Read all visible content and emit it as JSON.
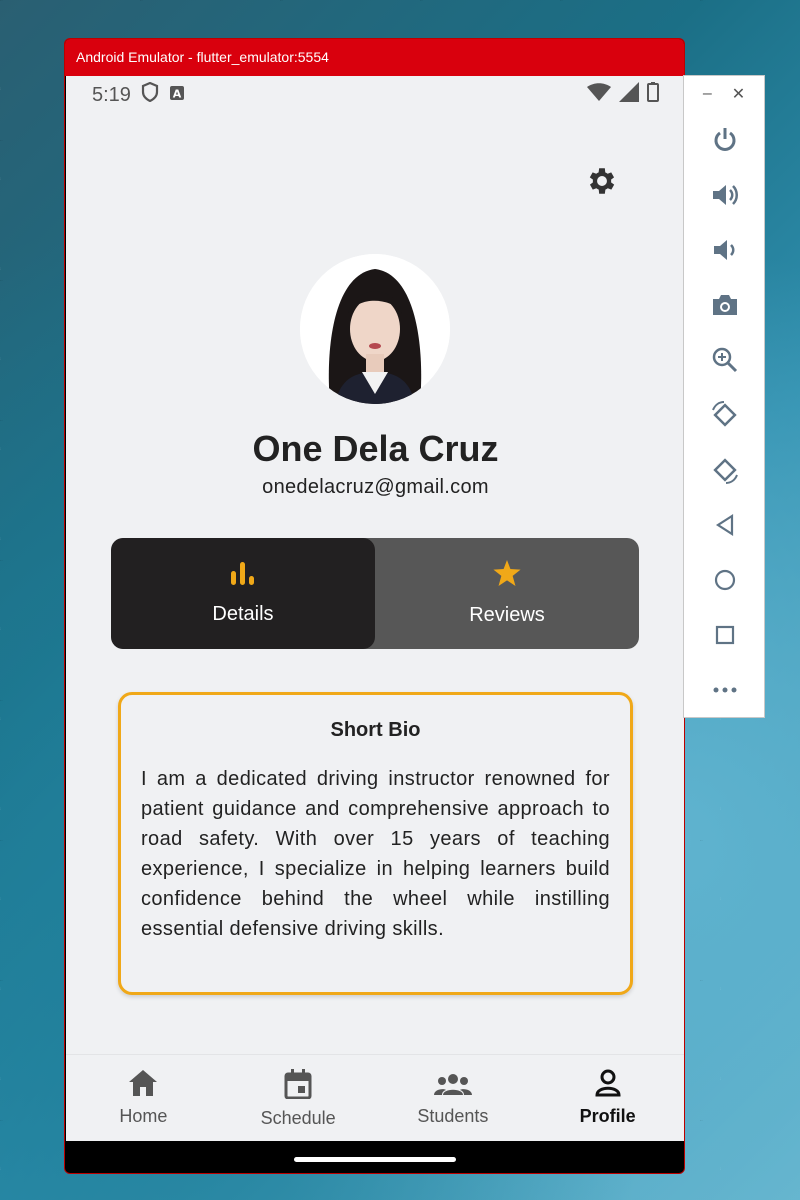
{
  "window": {
    "title": "Android Emulator - flutter_emulator:5554"
  },
  "status_bar": {
    "time": "5:19",
    "left_icons": [
      "shield-icon",
      "a-notification-icon"
    ],
    "right_icons": [
      "wifi-icon",
      "signal-icon",
      "battery-icon"
    ]
  },
  "profile": {
    "name": "One Dela Cruz",
    "email": "onedelacruz@gmail.com"
  },
  "tabs": [
    {
      "label": "Details",
      "icon": "bar-chart-icon",
      "active": true
    },
    {
      "label": "Reviews",
      "icon": "star-icon",
      "active": false
    }
  ],
  "bio": {
    "title": "Short Bio",
    "text": "I am a dedicated driving instructor renowned for patient guidance and comprehensive approach to road safety. With over 15 years of teaching experience, I specialize in helping learners build confidence behind the wheel while instilling essential defensive driving skills."
  },
  "bottom_nav": [
    {
      "label": "Home",
      "icon": "home-icon",
      "active": false
    },
    {
      "label": "Schedule",
      "icon": "calendar-icon",
      "active": false
    },
    {
      "label": "Students",
      "icon": "group-icon",
      "active": false
    },
    {
      "label": "Profile",
      "icon": "person-icon",
      "active": true
    }
  ],
  "side_panel": {
    "window_controls": [
      "minimize-icon",
      "close-icon"
    ],
    "buttons": [
      "power-icon",
      "volume-up-icon",
      "volume-down-icon",
      "camera-icon",
      "zoom-icon",
      "rotate-left-icon",
      "rotate-right-icon",
      "back-icon",
      "home-circle-icon",
      "overview-icon",
      "more-icon"
    ]
  },
  "colors": {
    "accent": "#f0a818",
    "title_bar": "#d9000d",
    "tab_active": "#222021",
    "tab_inactive": "#575757"
  }
}
